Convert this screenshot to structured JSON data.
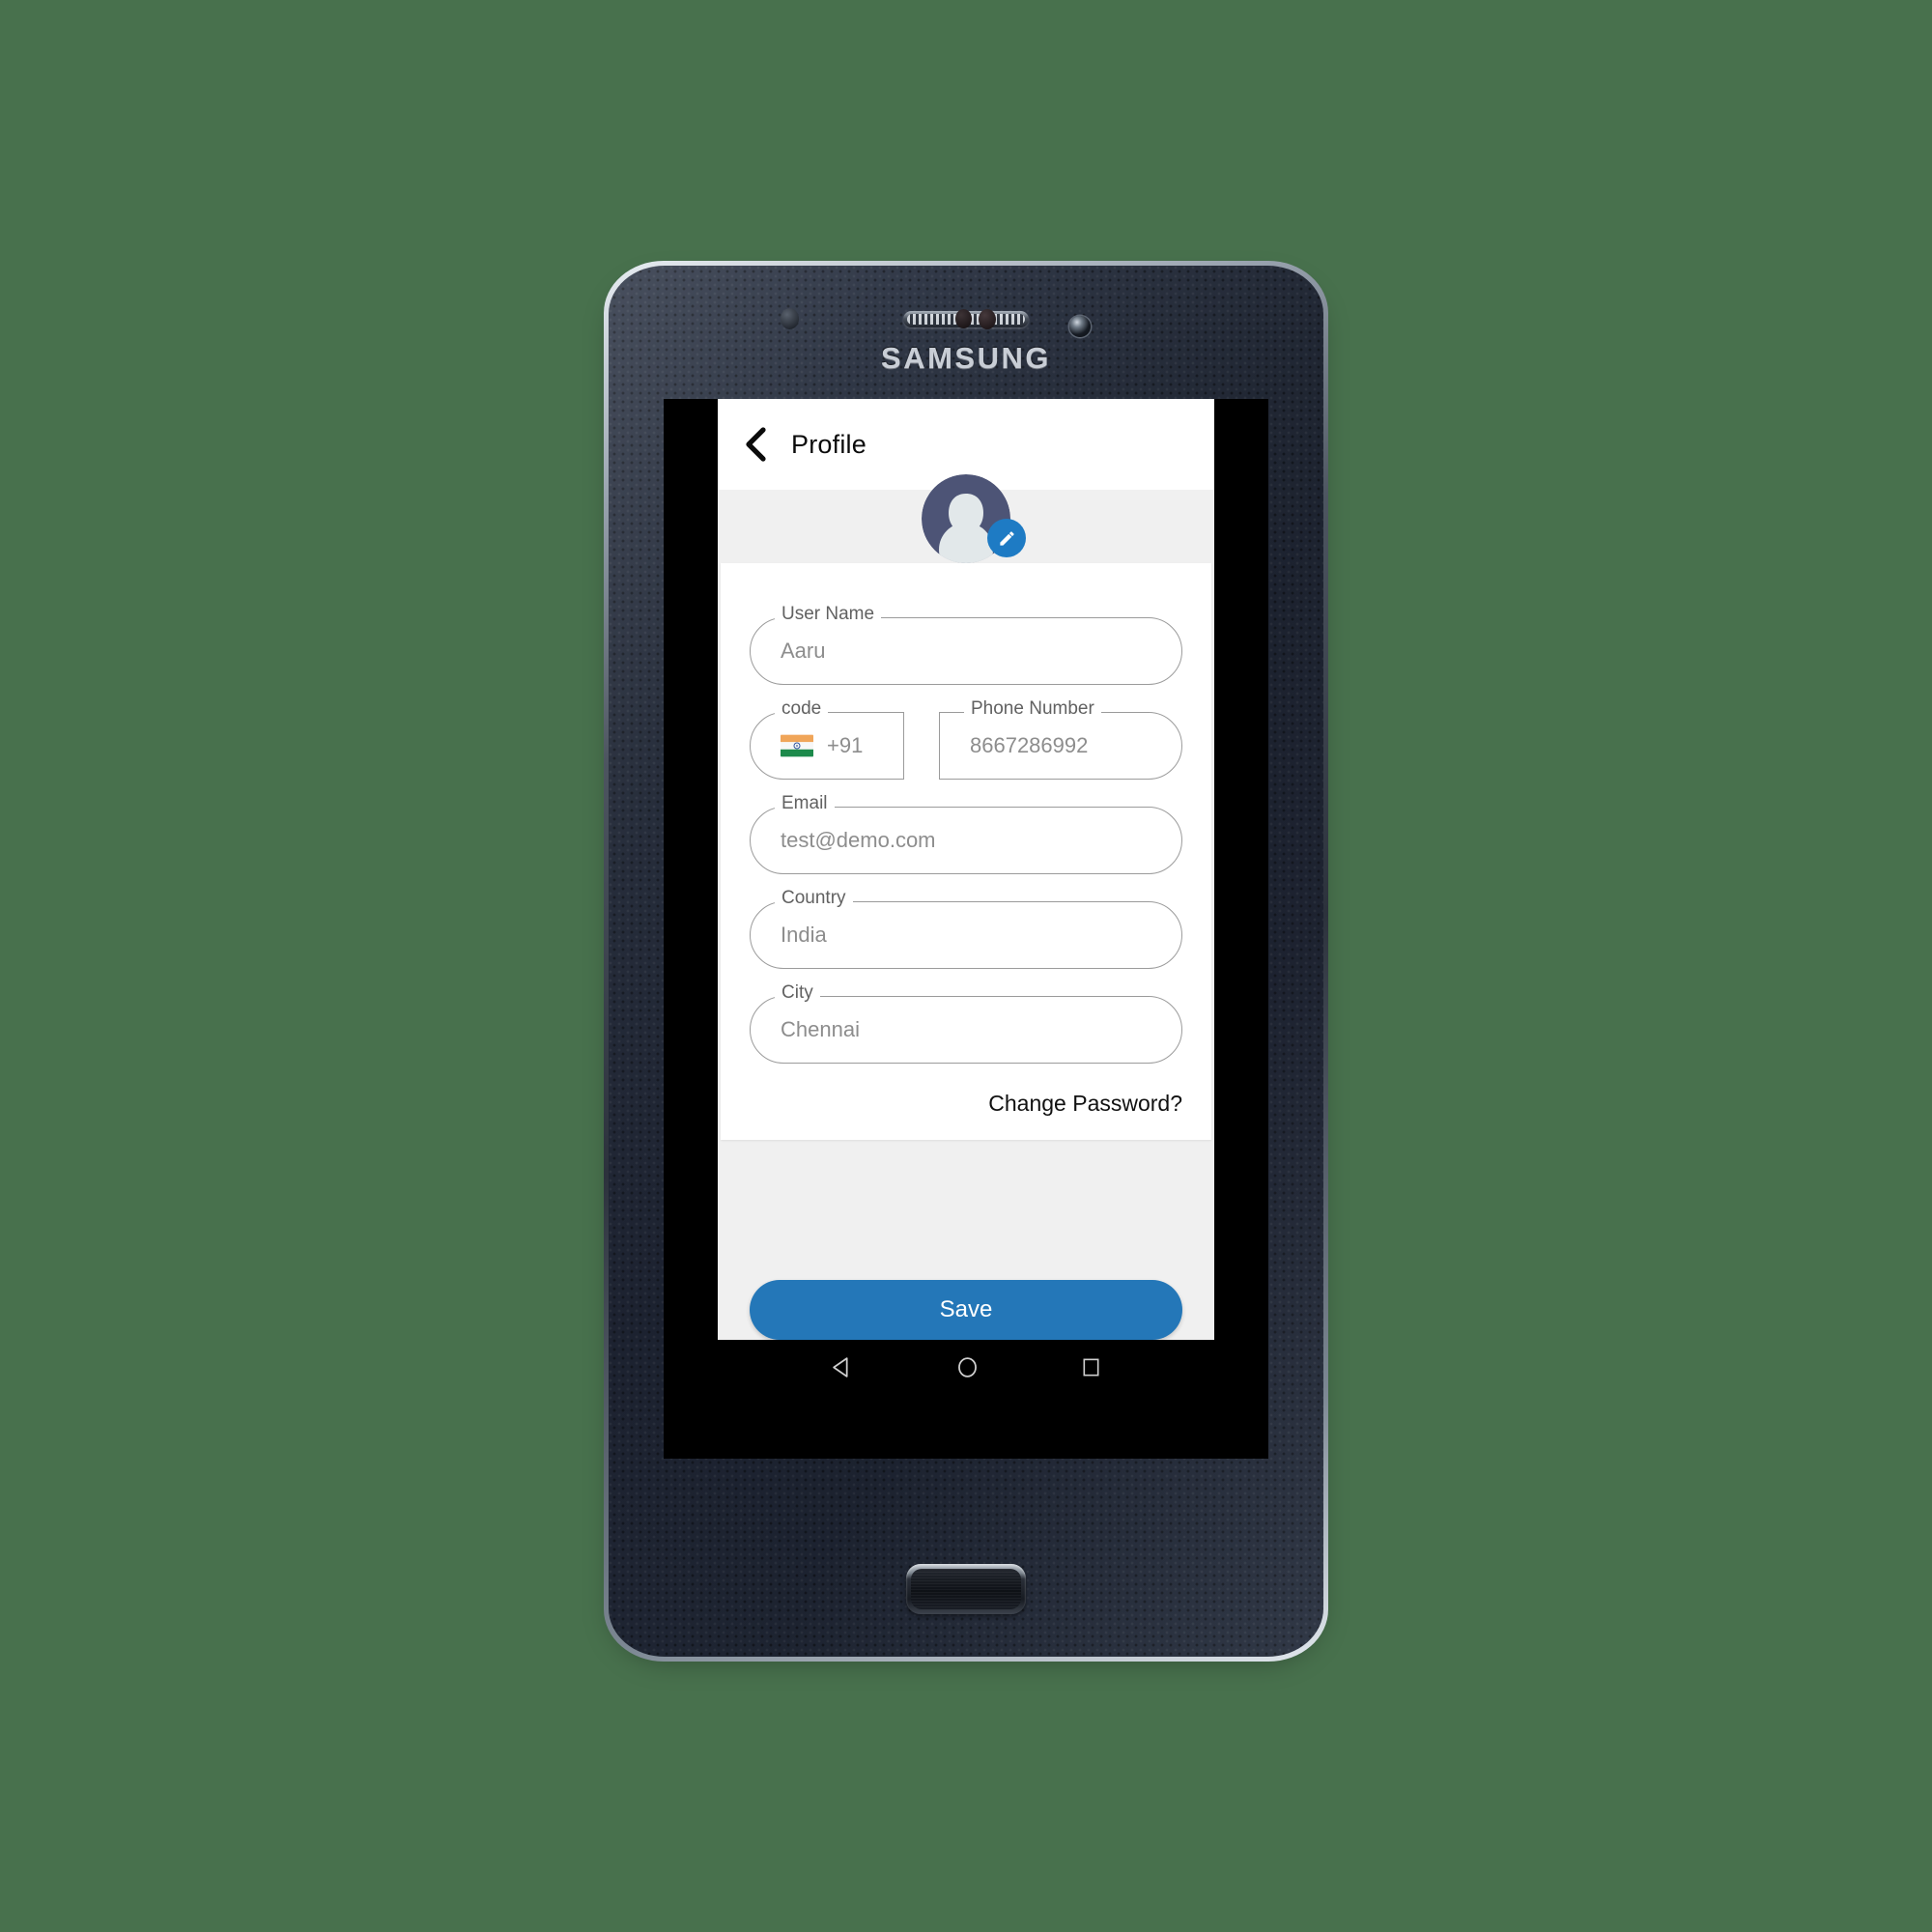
{
  "device": {
    "brand_label": "SAMSUNG",
    "hardware": {
      "earpiece": "speaker-grille",
      "front_camera": "front-camera",
      "home_button": "home-button"
    }
  },
  "colors": {
    "page_background": "#48714d",
    "app_background": "#f0f0f0",
    "card_background": "#ffffff",
    "accent_blue": "#2477b8",
    "edit_badge_blue": "#1e7bc4",
    "field_border": "#9b9b9b",
    "label_text": "#616161",
    "value_text": "#8d8d8d",
    "avatar_background": "#4d5476",
    "avatar_silhouette": "#e2e8ea"
  },
  "appbar": {
    "back_icon": "chevron-left-icon",
    "title": "Profile"
  },
  "avatar": {
    "icon": "user-avatar",
    "edit_icon": "pencil-icon"
  },
  "form": {
    "fields": [
      {
        "label": "User Name",
        "value": "Aaru"
      },
      {
        "label": "code",
        "value": "+91",
        "flag": "india-flag"
      },
      {
        "label": "Phone Number",
        "value": "8667286992"
      },
      {
        "label": "Email",
        "value": "test@demo.com"
      },
      {
        "label": "Country",
        "value": "India"
      },
      {
        "label": "City",
        "value": "Chennai"
      }
    ],
    "change_password_link": "Change Password?"
  },
  "actions": {
    "save_label": "Save"
  },
  "navbar": {
    "back": "android-back-icon",
    "home": "android-home-icon",
    "recents": "android-recents-icon"
  }
}
